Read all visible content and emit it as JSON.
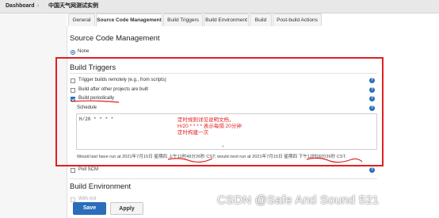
{
  "breadcrumb": {
    "home": "Dashboard",
    "separator": "›",
    "project": "中国天气网测试实例"
  },
  "tabs": [
    "General",
    "Source Code Management",
    "Build Triggers",
    "Build Environment",
    "Build",
    "Post-build Actions"
  ],
  "active_tab": "Source Code Management",
  "scm": {
    "title": "Source Code Management",
    "none_label": "None"
  },
  "triggers": {
    "title": "Build Triggers",
    "remote": "Trigger builds remotely (e.g., from scripts)",
    "after_other": "Build after other projects are built",
    "periodically": "Build periodically",
    "schedule_label": "Schedule",
    "schedule_value": "H/20 * * * *",
    "last_run": "Would last have run at 2021年7月15日 星期四 上午11时49分26秒 CST; would next run at 2021年7月15日 星期四 下午12时09分26秒 CST.",
    "poll_scm": "Poll SCM"
  },
  "annotation": [
    "定时规则详见说明文档，",
    "H/20 * * * * 表示每隔 20分钟",
    "定时构建一次"
  ],
  "build_env": {
    "title": "Build Environment",
    "option": "With Ant"
  },
  "buttons": {
    "save": "Save",
    "apply": "Apply"
  },
  "help_icon": "?",
  "watermark": "CSDN @Safe And Sound 521",
  "colors": {
    "accent": "#2a6ebb",
    "annotation_red": "#e02020"
  }
}
